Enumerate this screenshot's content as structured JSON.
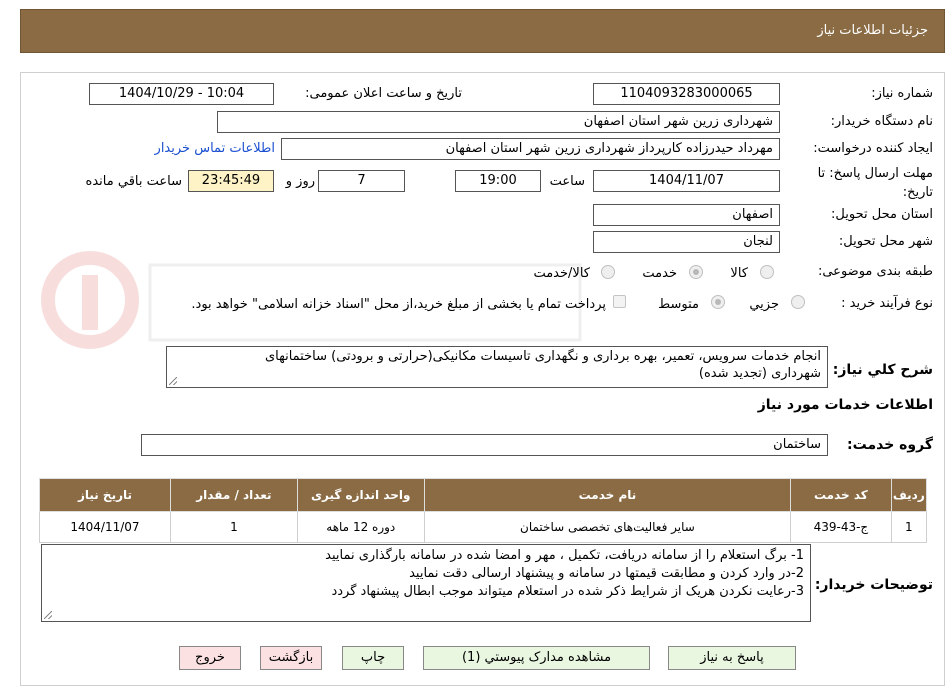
{
  "header": {
    "title": "جزئیات اطلاعات نیاز"
  },
  "form": {
    "need_number": {
      "label": "شماره نیاز:",
      "value": "1104093283000065"
    },
    "announce": {
      "label": "تاریخ و ساعت اعلان عمومی:",
      "value": "1404/10/29 - 10:04"
    },
    "buyer_org": {
      "label": "نام دستگاه خریدار:",
      "value": "شهرداری زرین شهر استان اصفهان"
    },
    "requester": {
      "label": "ایجاد کننده درخواست:",
      "value": "مهرداد حیدرزاده کارپرداز شهرداری زرین شهر استان اصفهان",
      "contact_link": "اطلاعات تماس خریدار"
    },
    "deadline": {
      "label_line1": "مهلت ارسال پاسخ: تا",
      "label_line2": "تاریخ:",
      "date": "1404/11/07",
      "time_label": "ساعت",
      "time": "19:00",
      "days": "7",
      "days_label": "روز و",
      "remaining": "23:45:49",
      "remaining_label": "ساعت باقي مانده"
    },
    "province": {
      "label": "استان محل تحویل:",
      "value": "اصفهان"
    },
    "city": {
      "label": "شهر محل تحویل:",
      "value": "لنجان"
    },
    "category": {
      "label": "طبقه بندی موضوعی:",
      "options": [
        "کالا",
        "خدمت",
        "کالا/خدمت"
      ],
      "selected": "خدمت"
    },
    "process": {
      "label": "نوع فرآیند خرید :",
      "options": [
        "جزیي",
        "متوسط"
      ],
      "selected": "متوسط",
      "payment_note": "پرداخت تمام یا بخشی از مبلغ خرید،از محل \"اسناد خزانه اسلامی\" خواهد بود."
    }
  },
  "description": {
    "label": "شرح كلي نياز:",
    "line1": "انجام خدمات سرویس، تعمیر، بهره برداری و نگهداری تاسیسات مکانیکی(حرارتی و برودتی) ساختمانهای",
    "line2": "شهرداری (تجدید شده)"
  },
  "services": {
    "section_title": "اطلاعات خدمات مورد نياز",
    "group_label": "گروه خدمت:",
    "group_value": "ساختمان",
    "columns": [
      "رديف",
      "کد خدمت",
      "نام خدمت",
      "واحد اندازه گیری",
      "تعداد / مقدار",
      "تاریخ نیاز"
    ],
    "rows": [
      [
        "1",
        "ج-43-439",
        "سایر فعالیت‌های تخصصی ساختمان",
        "دوره 12 ماهه",
        "1",
        "1404/11/07"
      ]
    ]
  },
  "buyer_notes": {
    "label": "توضیحات خریدار:",
    "lines": [
      "1- برگ استعلام را از سامانه دریافت، تکمیل ، مهر و امضا شده در سامانه بارگذاری نمایید",
      "2-در وارد کردن و مطابقت قیمتها در سامانه و پیشنهاد ارسالی دقت نمایید",
      "3-رعایت نکردن هریک از شرایط  ذکر شده در استعلام میتواند موجب ابطال پیشنهاد گردد"
    ]
  },
  "buttons": {
    "reply": "پاسخ به نیاز",
    "attachments": "مشاهده مدارک پیوستي (1)",
    "print": "چاپ",
    "back": "بازگشت",
    "exit": "خروج"
  },
  "colors": {
    "header_brown": "#8a6b43",
    "button_green": "#e9f7e1",
    "button_red": "#fbe1e1",
    "link_blue": "#1a4fd0"
  }
}
